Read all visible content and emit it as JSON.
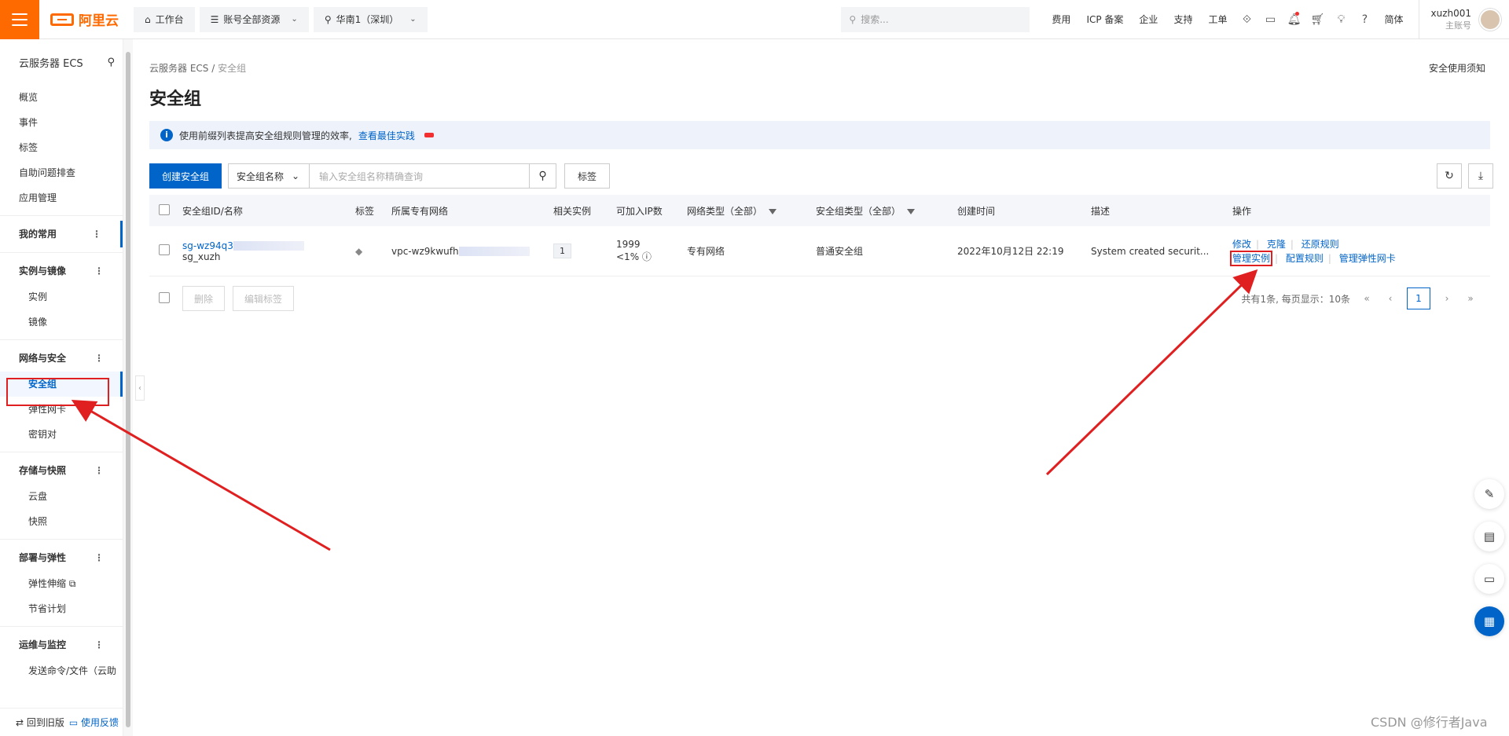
{
  "topbar": {
    "logo_text": "阿里云",
    "workbench": "工作台",
    "account_resources": "账号全部资源",
    "region": "华南1（深圳）",
    "search_placeholder": "搜索...",
    "links": [
      "费用",
      "ICP 备案",
      "企业",
      "支持",
      "工单"
    ],
    "lang": "简体",
    "username": "xuzh001",
    "user_role": "主账号"
  },
  "sidebar": {
    "title": "云服务器 ECS",
    "top_items": [
      "概览",
      "事件",
      "标签",
      "自助问题排查",
      "应用管理"
    ],
    "my_favorites": "我的常用",
    "groups": [
      {
        "name": "实例与镜像",
        "items": [
          "实例",
          "镜像"
        ]
      },
      {
        "name": "网络与安全",
        "items": [
          "安全组",
          "弹性网卡",
          "密钥对"
        ]
      },
      {
        "name": "存储与快照",
        "items": [
          "云盘",
          "快照"
        ]
      },
      {
        "name": "部署与弹性",
        "items": [
          "弹性伸缩",
          "节省计划"
        ]
      },
      {
        "name": "运维与监控",
        "items": [
          "发送命令/文件（云助"
        ]
      }
    ],
    "back_old": "回到旧版",
    "feedback": "使用反馈"
  },
  "main": {
    "breadcrumb_root": "云服务器 ECS",
    "breadcrumb_sep": "/",
    "breadcrumb_current": "安全组",
    "security_notice": "安全使用须知",
    "title": "安全组",
    "notice_text": "使用前缀列表提高安全组规则管理的效率,",
    "notice_link": "查看最佳实践",
    "create_button": "创建安全组",
    "search_field": "安全组名称",
    "search_placeholder": "输入安全组名称精确查询",
    "tag_button": "标签",
    "columns": [
      "安全组ID/名称",
      "标签",
      "所属专有网络",
      "相关实例",
      "可加入IP数",
      "网络类型（全部）",
      "安全组类型（全部）",
      "创建时间",
      "描述",
      "操作"
    ],
    "rows": [
      {
        "id": "sg-wz94q3",
        "name": "sg_xuzh",
        "vpc": "vpc-wz9kwufh",
        "instances": "1",
        "ip_count": "1999",
        "ip_pct": "<1%",
        "network_type": "专有网络",
        "sg_type": "普通安全组",
        "created": "2022年10月12日 22:19",
        "desc": "System created securit...",
        "ops": [
          "修改",
          "克隆",
          "还原规则",
          "管理实例",
          "配置规则",
          "管理弹性网卡"
        ]
      }
    ],
    "delete_button": "删除",
    "edit_tag_button": "编辑标签",
    "pagination_summary": "共有1条, 每页显示：10条",
    "current_page": "1"
  },
  "watermark": "CSDN @修行者Java"
}
